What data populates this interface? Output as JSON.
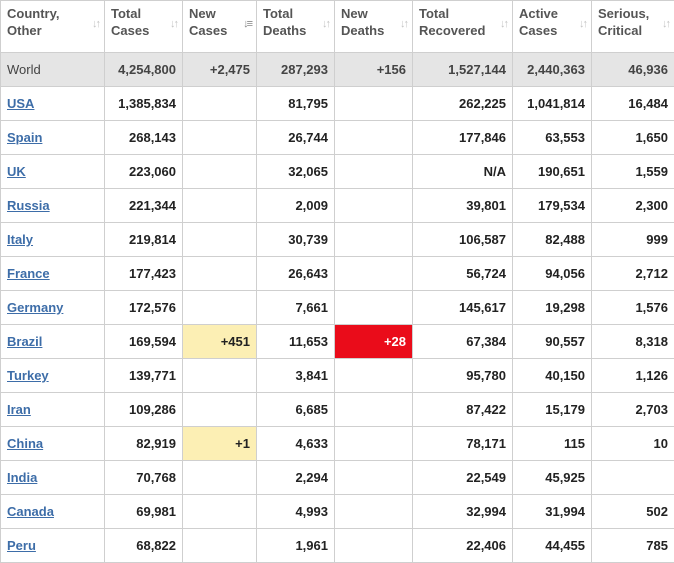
{
  "columns": [
    {
      "line1": "Country,",
      "line2": "Other"
    },
    {
      "line1": "Total",
      "line2": "Cases"
    },
    {
      "line1": "New",
      "line2": "Cases"
    },
    {
      "line1": "Total",
      "line2": "Deaths"
    },
    {
      "line1": "New",
      "line2": "Deaths"
    },
    {
      "line1": "Total",
      "line2": "Recovered"
    },
    {
      "line1": "Active",
      "line2": "Cases"
    },
    {
      "line1": "Serious,",
      "line2": "Critical"
    }
  ],
  "sort_icon": "sort-arrows-icon",
  "world": {
    "country": "World",
    "total_cases": "4,254,800",
    "new_cases": "+2,475",
    "total_deaths": "287,293",
    "new_deaths": "+156",
    "total_recovered": "1,527,144",
    "active_cases": "2,440,363",
    "serious_critical": "46,936"
  },
  "rows": [
    {
      "country": "USA",
      "total_cases": "1,385,834",
      "new_cases": "",
      "total_deaths": "81,795",
      "new_deaths": "",
      "total_recovered": "262,225",
      "active_cases": "1,041,814",
      "serious_critical": "16,484"
    },
    {
      "country": "Spain",
      "total_cases": "268,143",
      "new_cases": "",
      "total_deaths": "26,744",
      "new_deaths": "",
      "total_recovered": "177,846",
      "active_cases": "63,553",
      "serious_critical": "1,650"
    },
    {
      "country": "UK",
      "total_cases": "223,060",
      "new_cases": "",
      "total_deaths": "32,065",
      "new_deaths": "",
      "total_recovered": "N/A",
      "active_cases": "190,651",
      "serious_critical": "1,559"
    },
    {
      "country": "Russia",
      "total_cases": "221,344",
      "new_cases": "",
      "total_deaths": "2,009",
      "new_deaths": "",
      "total_recovered": "39,801",
      "active_cases": "179,534",
      "serious_critical": "2,300"
    },
    {
      "country": "Italy",
      "total_cases": "219,814",
      "new_cases": "",
      "total_deaths": "30,739",
      "new_deaths": "",
      "total_recovered": "106,587",
      "active_cases": "82,488",
      "serious_critical": "999"
    },
    {
      "country": "France",
      "total_cases": "177,423",
      "new_cases": "",
      "total_deaths": "26,643",
      "new_deaths": "",
      "total_recovered": "56,724",
      "active_cases": "94,056",
      "serious_critical": "2,712"
    },
    {
      "country": "Germany",
      "total_cases": "172,576",
      "new_cases": "",
      "total_deaths": "7,661",
      "new_deaths": "",
      "total_recovered": "145,617",
      "active_cases": "19,298",
      "serious_critical": "1,576"
    },
    {
      "country": "Brazil",
      "total_cases": "169,594",
      "new_cases": "+451",
      "total_deaths": "11,653",
      "new_deaths": "+28",
      "total_recovered": "67,384",
      "active_cases": "90,557",
      "serious_critical": "8,318"
    },
    {
      "country": "Turkey",
      "total_cases": "139,771",
      "new_cases": "",
      "total_deaths": "3,841",
      "new_deaths": "",
      "total_recovered": "95,780",
      "active_cases": "40,150",
      "serious_critical": "1,126"
    },
    {
      "country": "Iran",
      "total_cases": "109,286",
      "new_cases": "",
      "total_deaths": "6,685",
      "new_deaths": "",
      "total_recovered": "87,422",
      "active_cases": "15,179",
      "serious_critical": "2,703"
    },
    {
      "country": "China",
      "total_cases": "82,919",
      "new_cases": "+1",
      "total_deaths": "4,633",
      "new_deaths": "",
      "total_recovered": "78,171",
      "active_cases": "115",
      "serious_critical": "10"
    },
    {
      "country": "India",
      "total_cases": "70,768",
      "new_cases": "",
      "total_deaths": "2,294",
      "new_deaths": "",
      "total_recovered": "22,549",
      "active_cases": "45,925",
      "serious_critical": ""
    },
    {
      "country": "Canada",
      "total_cases": "69,981",
      "new_cases": "",
      "total_deaths": "4,993",
      "new_deaths": "",
      "total_recovered": "32,994",
      "active_cases": "31,994",
      "serious_critical": "502"
    },
    {
      "country": "Peru",
      "total_cases": "68,822",
      "new_cases": "",
      "total_deaths": "1,961",
      "new_deaths": "",
      "total_recovered": "22,406",
      "active_cases": "44,455",
      "serious_critical": "785"
    }
  ],
  "colors": {
    "new_cases_highlight": "#fcefb4",
    "new_deaths_highlight": "#ea0c1a",
    "world_row_bg": "#e5e5e5",
    "link": "#3d6da8"
  }
}
